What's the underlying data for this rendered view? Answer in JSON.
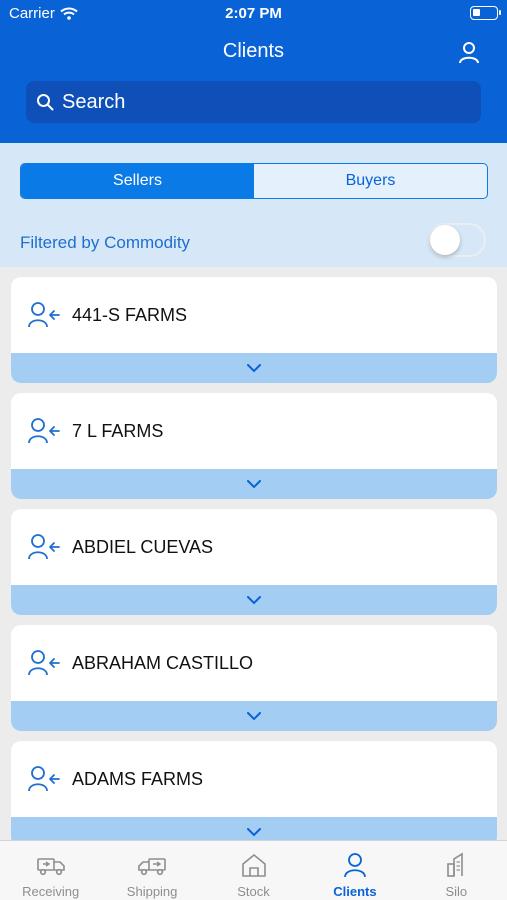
{
  "status": {
    "carrier": "Carrier",
    "time": "2:07 PM"
  },
  "nav": {
    "title": "Clients",
    "profile_icon": "user-icon"
  },
  "search": {
    "placeholder": "Search"
  },
  "segment": {
    "sellers": "Sellers",
    "buyers": "Buyers",
    "selected": "Sellers"
  },
  "filter": {
    "label": "Filtered by Commodity",
    "enabled": false
  },
  "clients": [
    {
      "name": "441-S FARMS"
    },
    {
      "name": "7 L FARMS"
    },
    {
      "name": "ABDIEL CUEVAS"
    },
    {
      "name": "ABRAHAM CASTILLO"
    },
    {
      "name": "ADAMS FARMS"
    }
  ],
  "tabs": [
    {
      "label": "Receiving",
      "icon": "truck-receiving-icon"
    },
    {
      "label": "Shipping",
      "icon": "truck-shipping-icon"
    },
    {
      "label": "Stock",
      "icon": "warehouse-icon"
    },
    {
      "label": "Clients",
      "icon": "user-icon",
      "active": true
    },
    {
      "label": "Silo",
      "icon": "silo-icon"
    }
  ],
  "colors": {
    "primary": "#0a63d6",
    "accent": "#0a7ae6",
    "panel": "#d6e8f8",
    "expander": "#a4cdf3"
  }
}
